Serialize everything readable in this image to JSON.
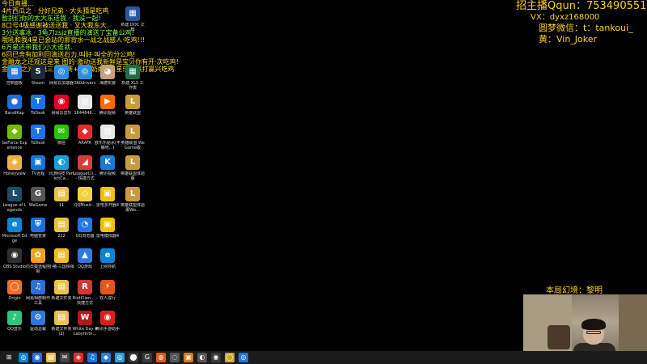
{
  "chat": [
    {
      "text": "今日直播…",
      "color": "#ffe000"
    },
    {
      "text": "4片西瓜之 · 分好兄弟 · 大头猜是吃鸡",
      "color": "#ffe000"
    },
    {
      "text": "暂别们你的太大东送我 · 我没一起!",
      "color": "#7dff3a"
    },
    {
      "text": "8口号4级感谢被送送我 · 又大我东大.",
      "color": "#ffe000"
    },
    {
      "text": "3分送事冰 · 3龟刀zsjz直播的演送了宝备公鸡!",
      "color": "#7dff3a"
    },
    {
      "text": "哦吼和我4星已会站的那背水一战之战感人·吃鸡!!!",
      "color": "#ffe000"
    },
    {
      "text": "6万星还带我们小大谁就.",
      "color": "#7dff3a"
    },
    {
      "text": "6回已舍有加利回演送石力.叫好·叫全的分公鸡!",
      "color": "#ffe000"
    },
    {
      "text": "金雕龙之还观这是来·图的·激动送我新鲜是宝贝你有开·次吃鸡!",
      "color": "#ffe000"
    },
    {
      "text": "金鳞龙之光观冠三星巴赛+三星奶妈+三星乐观赢打赢兴吃鸡",
      "color": "#ffe000"
    }
  ],
  "streamer": {
    "qq": "招主播Qqun：753490551",
    "vx": "VX：dyxz168000",
    "wechat": "圆梦微信：t：tankoui_",
    "huang": "黄：Vin_Joker"
  },
  "bgm": "本局幻境：黎明",
  "desktop_icons": [
    {
      "label": "控制面板",
      "glyph": "▦",
      "color": "#2a7bd4"
    },
    {
      "label": "BandiKap",
      "glyph": "●",
      "color": "#1f6fd1"
    },
    {
      "label": "GeForce Experience",
      "glyph": "◆",
      "color": "#76b900"
    },
    {
      "label": "Honeyview",
      "glyph": "◈",
      "color": "#e8b44a"
    },
    {
      "label": "League of Legends",
      "glyph": "L",
      "color": "#1d4d66"
    },
    {
      "label": "Microsoft Edge",
      "glyph": "e",
      "color": "#0a84d8"
    },
    {
      "label": "OBS Studio",
      "glyph": "◉",
      "color": "#303030"
    },
    {
      "label": "Origin",
      "glyph": "◯",
      "color": "#f56c2d"
    },
    {
      "label": "QQ音乐",
      "glyph": "♪",
      "color": "#31c27c"
    },
    {
      "label": "Steam",
      "glyph": "S",
      "color": "#1b2838"
    },
    {
      "label": "ToDesk",
      "glyph": "T",
      "color": "#1a74e8"
    },
    {
      "label": "ToDesk",
      "glyph": "T",
      "color": "#1a74e8"
    },
    {
      "label": "TV远程",
      "glyph": "▣",
      "color": "#0d76d6"
    },
    {
      "label": "WeGame",
      "glyph": "G",
      "color": "#555"
    },
    {
      "label": "电脑管家",
      "glyph": "⛨",
      "color": "#1a6fe0"
    },
    {
      "label": "向日葵远程控制",
      "glyph": "✿",
      "color": "#f7a11a"
    },
    {
      "label": "网易相册制作工具",
      "glyph": "♫",
      "color": "#2d6fd3"
    },
    {
      "label": "驱动总裁",
      "glyph": "⚙",
      "color": "#2d78d8"
    },
    {
      "label": "网易云加速器",
      "glyph": "◎",
      "color": "#2e8de0"
    },
    {
      "label": "网易云音乐",
      "glyph": "◉",
      "color": "#e60026"
    },
    {
      "label": "微信",
      "glyph": "✉",
      "color": "#2dc100"
    },
    {
      "label": "讯游科技 PerfectCa...",
      "glyph": "◐",
      "color": "#15a0d8"
    },
    {
      "label": "11",
      "glyph": "▤",
      "color": "#e8c34a"
    },
    {
      "label": "222",
      "glyph": "▤",
      "color": "#e8c34a"
    },
    {
      "label": "小猪-三国快报",
      "glyph": "▤",
      "color": "#f0c020"
    },
    {
      "label": "新建文件夹",
      "glyph": "▤",
      "color": "#e8c34a"
    },
    {
      "label": "新建文件夹(2)",
      "glyph": "▤",
      "color": "#e8c34a"
    },
    {
      "label": "360drivers",
      "glyph": "◎",
      "color": "#2c8fe0"
    },
    {
      "label": "1644646...",
      "glyph": "▥",
      "color": "#e6e6e6"
    },
    {
      "label": "ARAFA",
      "glyph": "◆",
      "color": "#e42a2a"
    },
    {
      "label": "LeagueCli... - 快捷方式",
      "glyph": "◢",
      "color": "#d93b3b"
    },
    {
      "label": "QQMusic...",
      "glyph": "◇",
      "color": "#f4d03f"
    },
    {
      "label": "QQ浏览器",
      "glyph": "◔",
      "color": "#2176e8"
    },
    {
      "label": "QQ游戏",
      "glyph": "▲",
      "color": "#2b7be0"
    },
    {
      "label": "RiotClien... - 快捷方式",
      "glyph": "R",
      "color": "#d13639"
    },
    {
      "label": "White Day A Labyrinth...",
      "glyph": "W",
      "color": "#b3181c"
    },
    {
      "label": "海德实装",
      "glyph": "◕",
      "color": "#c8a080"
    },
    {
      "label": "腾讯视频",
      "glyph": "▶",
      "color": "#ff6a00"
    },
    {
      "label": "欧乐乐给水(平静地...)",
      "glyph": "▧",
      "color": "#e8e8e8"
    },
    {
      "label": "腾讯视频",
      "glyph": "K",
      "color": "#1a7ad8"
    },
    {
      "label": "雷电多开器4",
      "glyph": "▣",
      "color": "#f2c200"
    },
    {
      "label": "雷电模拟器4",
      "glyph": "▣",
      "color": "#f2c200"
    },
    {
      "label": "上网导航",
      "glyph": "e",
      "color": "#0a84d8"
    },
    {
      "label": "双人成行",
      "glyph": "⚡",
      "color": "#e3541f"
    },
    {
      "label": "腾讯手游助手",
      "glyph": "◉",
      "color": "#d62020"
    },
    {
      "label": "新建 DOC 文档",
      "glyph": "▦",
      "color": "#2b579a"
    },
    {
      "label": "新建 XLS 工作表",
      "glyph": "▦",
      "color": "#1d6f42"
    },
    {
      "label": "英雄联盟",
      "glyph": "L",
      "color": "#c89b3c"
    },
    {
      "label": "英雄联盟 WeGame版",
      "glyph": "L",
      "color": "#c89b3c"
    },
    {
      "label": "英雄联盟体验服",
      "glyph": "L",
      "color": "#c89b3c"
    },
    {
      "label": "英雄联盟体验服Wo...",
      "glyph": "L",
      "color": "#c89b3c"
    }
  ],
  "taskbar": [
    {
      "glyph": "⊞",
      "color": "#1c1c1c",
      "name": "start"
    },
    {
      "glyph": "◎",
      "color": "#0a84d8",
      "name": "edge"
    },
    {
      "glyph": "◉",
      "color": "#2a6de0",
      "name": "task"
    },
    {
      "glyph": "▤",
      "color": "#e8c34a",
      "name": "explorer"
    },
    {
      "glyph": "✉",
      "color": "#444",
      "name": "mail"
    },
    {
      "glyph": "◈",
      "color": "#e62a2a",
      "name": "app-red"
    },
    {
      "glyph": "♫",
      "color": "#1a73e8",
      "name": "music"
    },
    {
      "glyph": "◆",
      "color": "#2b7be0",
      "name": "app-blue"
    },
    {
      "glyph": "◎",
      "color": "#2d9cdb",
      "name": "browser"
    },
    {
      "glyph": "⬤",
      "color": "#3b3b3b",
      "name": "app-dark"
    },
    {
      "glyph": "G",
      "color": "#3a3a3a",
      "name": "wegame"
    },
    {
      "glyph": "◍",
      "color": "#e05a1a",
      "name": "origin"
    },
    {
      "glyph": "◌",
      "color": "#555",
      "name": "app-gray"
    },
    {
      "glyph": "▣",
      "color": "#d97a1e",
      "name": "app-orange"
    },
    {
      "glyph": "◐",
      "color": "#555",
      "name": "app-gray2"
    },
    {
      "glyph": "◉",
      "color": "#3a3a3a",
      "name": "obs"
    },
    {
      "glyph": "◯",
      "color": "#c7a92f",
      "name": "app-yellow"
    },
    {
      "glyph": "◎",
      "color": "#2176e8",
      "name": "qq-browser"
    }
  ]
}
